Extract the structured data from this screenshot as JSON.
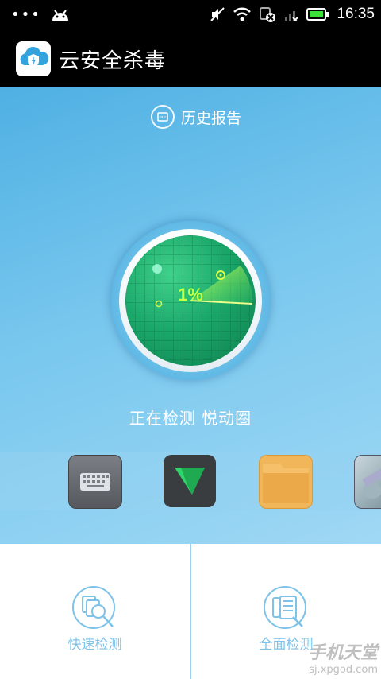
{
  "status_bar": {
    "time": "16:35",
    "icons": [
      "more-dots-icon",
      "android-icon",
      "mute-icon",
      "wifi-icon",
      "notification-icon",
      "signal-icon",
      "battery-icon"
    ]
  },
  "app_bar": {
    "title": "云安全杀毒",
    "icon": "cloud-shield-icon"
  },
  "scan": {
    "history_label": "历史报告",
    "progress_text": "1%",
    "progress": 0.01,
    "status_text": "正在检测 悦动圈"
  },
  "app_strip": {
    "apps": [
      "keyboard-app-icon",
      "green-arrow-app-icon",
      "folder-app-icon",
      "photo-app-icon"
    ]
  },
  "actions": [
    {
      "label": "快速检测",
      "icon": "quick-scan-icon"
    },
    {
      "label": "全面检测",
      "icon": "full-scan-icon"
    }
  ],
  "watermark": {
    "main": "手机天堂",
    "sub": "sj.xpgod.com"
  },
  "colors": {
    "accent": "#7dc2e8",
    "radar_green": "#1aa86a",
    "top_bar": "#000000"
  }
}
